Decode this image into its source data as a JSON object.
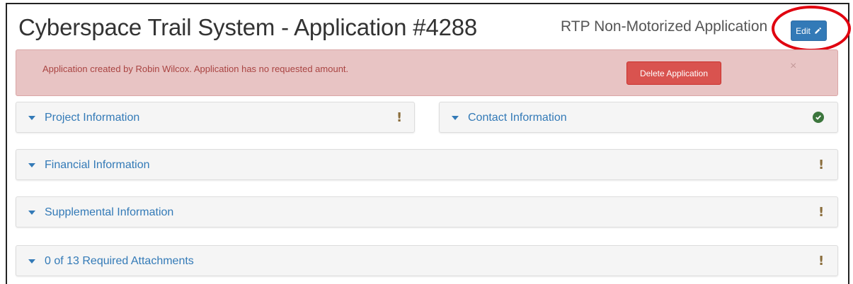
{
  "header": {
    "title": "Cyberspace Trail System - Application #4288",
    "application_type": "RTP Non-Motorized Application",
    "edit_label": "Edit"
  },
  "alert": {
    "message": "Application created by Robin Wilcox. Application has no requested amount.",
    "delete_label": "Delete Application",
    "close_glyph": "×"
  },
  "panels": [
    {
      "label": "Project Information",
      "status": "warning",
      "status_glyph": "!"
    },
    {
      "label": "Contact Information",
      "status": "complete"
    },
    {
      "label": "Financial Information",
      "status": "warning",
      "status_glyph": "!"
    },
    {
      "label": "Supplemental Information",
      "status": "warning",
      "status_glyph": "!"
    },
    {
      "label": "0 of 13 Required Attachments",
      "status": "warning",
      "status_glyph": "!"
    }
  ],
  "colors": {
    "primary": "#337ab7",
    "danger": "#d9534f",
    "alert_bg": "#e8c4c4",
    "alert_text": "#a94442",
    "warning": "#8a6d3b",
    "success": "#3c763d",
    "annotation": "#e0000f"
  },
  "icons": {
    "edit": "pencil-icon",
    "panel_toggle": "caret-down-icon",
    "warning": "exclamation-icon",
    "complete": "check-circle-icon"
  }
}
